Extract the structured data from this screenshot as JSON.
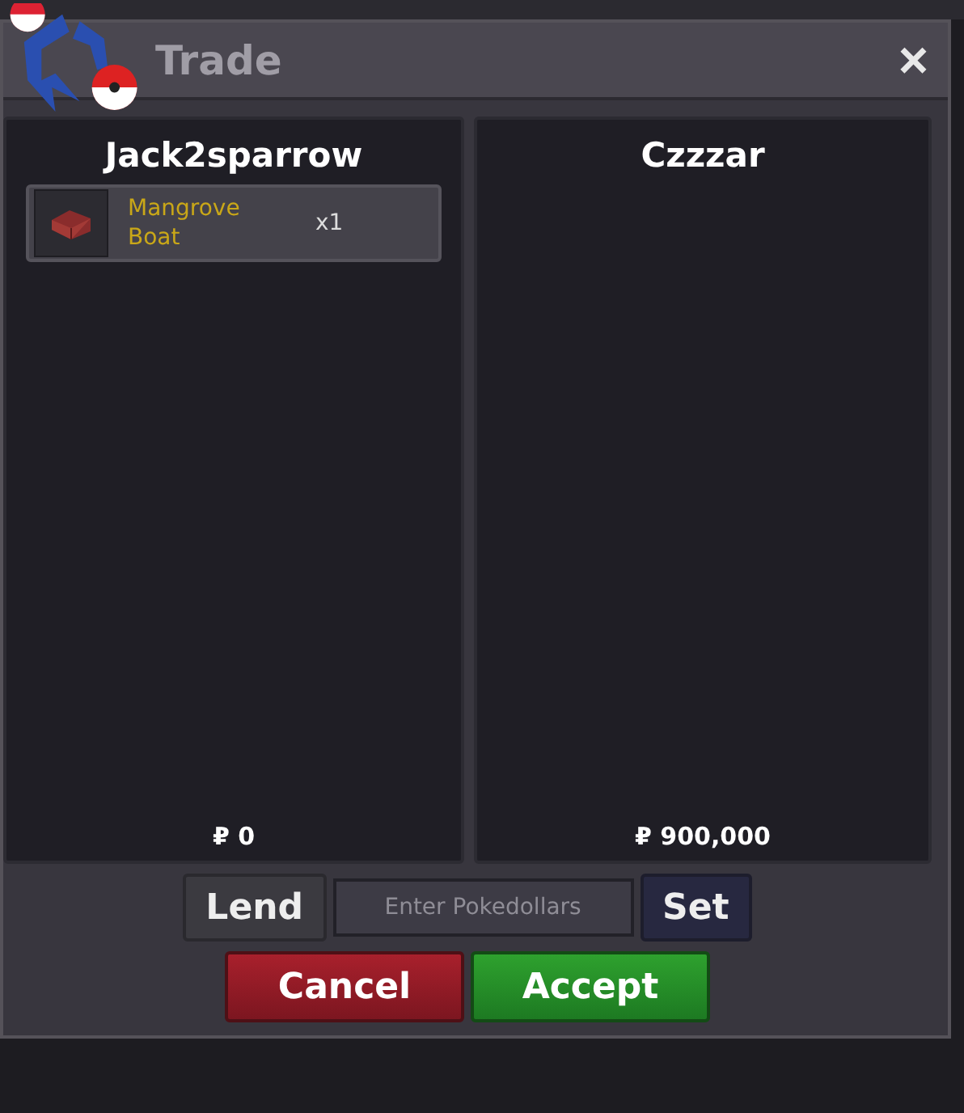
{
  "window": {
    "title": "Trade",
    "close": "×"
  },
  "panels": [
    {
      "player": "Jack2sparrow",
      "items": [
        {
          "name": "Mangrove Boat",
          "quantity": "x1"
        }
      ],
      "money": "₽ 0"
    },
    {
      "player": "Czzzar",
      "money": "₽ 900,000"
    }
  ],
  "lend_button": "Lend",
  "money_field": {
    "placeholder": "Enter Pokedollars"
  },
  "set_button": "Set",
  "cancel_button": "Cancel",
  "accept_button": "Accept"
}
